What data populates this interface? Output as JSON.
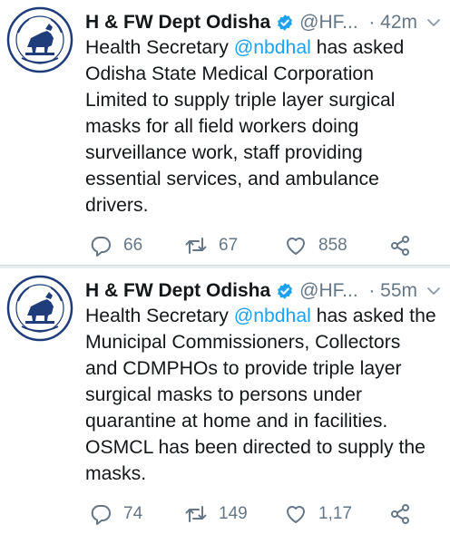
{
  "colors": {
    "link": "#1da1f2",
    "muted": "#657786",
    "text": "#14171a",
    "verified": "#1da1f2"
  },
  "tweets": [
    {
      "name": "H & FW Dept Odisha",
      "handle": "@HF...",
      "time": "· 42m",
      "text_before": "Health Secretary ",
      "mention": "@nbdhal",
      "text_after": " has asked\nOdisha State Medical Corporation\nLimited to supply triple layer surgical\nmasks for all field workers doing\nsurveillance work, staff providing\nessential services, and ambulance\ndrivers.",
      "replies": "66",
      "retweets": "67",
      "likes": "858"
    },
    {
      "name": "H & FW Dept Odisha",
      "handle": "@HF...",
      "time": "· 55m",
      "text_before": "Health Secretary ",
      "mention": "@nbdhal",
      "text_after": " has asked the\nMunicipal Commissioners, Collectors\nand CDMPHOs to provide triple layer\nsurgical masks to persons under\nquarantine at home and in facilities.\nOSMCL has been directed to supply the\nmasks.",
      "replies": "74",
      "retweets": "149",
      "likes": "1,17"
    }
  ],
  "icons": {
    "avatar": "odisha-emblem-icon",
    "verified": "verified-badge-icon",
    "menu": "chevron-down-icon",
    "reply": "reply-icon",
    "retweet": "retweet-icon",
    "like": "heart-icon",
    "share": "share-icon"
  }
}
